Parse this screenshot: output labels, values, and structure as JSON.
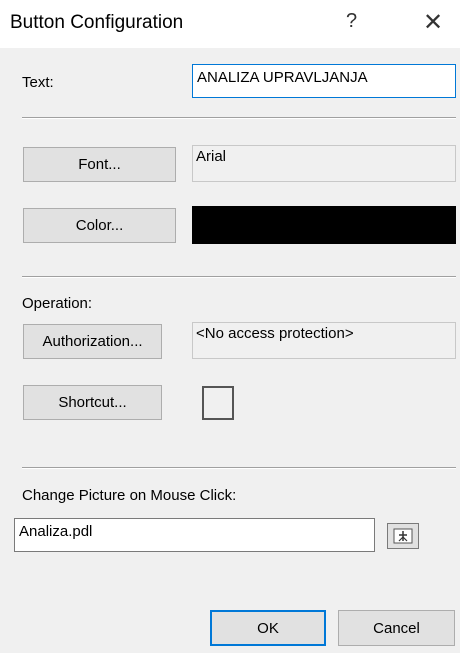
{
  "window": {
    "title": "Button Configuration",
    "help": "?",
    "close": "✕"
  },
  "text_field": {
    "label": "Text:",
    "value": "ANALIZA UPRAVLJANJA"
  },
  "font": {
    "button": "Font...",
    "value": "Arial"
  },
  "color": {
    "button": "Color...",
    "swatch": "#000000"
  },
  "operation": {
    "label": "Operation:",
    "authorization_button": "Authorization...",
    "authorization_value": "<No access protection>",
    "shortcut_button": "Shortcut..."
  },
  "picture": {
    "label": "Change Picture on Mouse Click:",
    "value": "Analiza.pdl",
    "browse_icon": "browse-picture-icon"
  },
  "footer": {
    "ok": "OK",
    "cancel": "Cancel"
  }
}
